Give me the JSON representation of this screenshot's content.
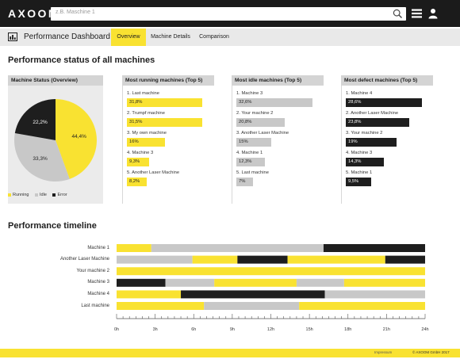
{
  "app": {
    "logo": "AXOOM",
    "search_placeholder": "z.B. Maschine 1"
  },
  "tabbar": {
    "title": "Performance Dashboard",
    "tabs": [
      {
        "label": "Overview",
        "active": true
      },
      {
        "label": "Machine Details",
        "active": false
      },
      {
        "label": "Comparison",
        "active": false
      }
    ]
  },
  "status_section": {
    "heading": "Performance status of all machines",
    "overview": {
      "title": "Machine Status (Overview)",
      "legend": [
        "Running",
        "Idle",
        "Error"
      ]
    },
    "top_running": {
      "title": "Most running machines (Top 5)",
      "items": [
        {
          "label": "1. Last machine",
          "value": "31,8%"
        },
        {
          "label": "2. Trumpf machine",
          "value": "31,5%"
        },
        {
          "label": "3. My own machine",
          "value": "16%"
        },
        {
          "label": "4. Machine 3",
          "value": "9,3%"
        },
        {
          "label": "5. Another Laser Machine",
          "value": "8,2%"
        }
      ]
    },
    "top_idle": {
      "title": "Most idle machines (Top 5)",
      "items": [
        {
          "label": "1. Machine 3",
          "value": "32,6%"
        },
        {
          "label": "2. Your machine 2",
          "value": "20,8%"
        },
        {
          "label": "3. Another Laser Machine",
          "value": "15%"
        },
        {
          "label": "4. Machine 1",
          "value": "12,3%"
        },
        {
          "label": "5. Last machine",
          "value": "7%"
        }
      ]
    },
    "top_defect": {
      "title": "Most defect machines (Top 5)",
      "items": [
        {
          "label": "1. Machine 4",
          "value": "28,6%"
        },
        {
          "label": "2. Another Laser Machine",
          "value": "23,8%"
        },
        {
          "label": "3. Your machine 2",
          "value": "19%"
        },
        {
          "label": "4. Machine 3",
          "value": "14,3%"
        },
        {
          "label": "5. Machine 1",
          "value": "9,5%"
        }
      ]
    }
  },
  "timeline_section": {
    "heading": "Performance timeline",
    "machines": [
      "Machine 1",
      "Another Laser Machine",
      "Your machine 2",
      "Machine 3",
      "Machine 4",
      "Last machine"
    ],
    "x_ticks": [
      "0h",
      "3h",
      "6h",
      "9h",
      "12h",
      "15h",
      "18h",
      "21h",
      "24h"
    ]
  },
  "footer": {
    "mid_text": "Impressum",
    "copyright": "© AXOOM GmbH 2017"
  },
  "colors": {
    "running": "#f9e231",
    "idle": "#c8c8c8",
    "error": "#1e1e1e"
  },
  "chart_data": [
    {
      "type": "pie",
      "title": "Machine Status (Overview)",
      "labels": [
        "Running",
        "Idle",
        "Error"
      ],
      "values": [
        44.4,
        33.3,
        22.2
      ],
      "value_labels": [
        "44,4%",
        "33,3%",
        "22,2%"
      ],
      "colors": [
        "#f9e231",
        "#c8c8c8",
        "#1e1e1e"
      ],
      "legend": "bottom"
    },
    {
      "type": "bar",
      "title": "Most running machines (Top 5)",
      "categories": [
        "Last machine",
        "Trumpf machine",
        "My own machine",
        "Machine 3",
        "Another Laser Machine"
      ],
      "values": [
        31.8,
        31.5,
        16,
        9.3,
        8.2
      ],
      "color": "#f9e231"
    },
    {
      "type": "bar",
      "title": "Most idle machines (Top 5)",
      "categories": [
        "Machine 3",
        "Your machine 2",
        "Another Laser Machine",
        "Machine 1",
        "Last machine"
      ],
      "values": [
        32.6,
        20.8,
        15,
        12.3,
        7
      ],
      "color": "#c8c8c8"
    },
    {
      "type": "bar",
      "title": "Most defect machines (Top 5)",
      "categories": [
        "Machine 4",
        "Another Laser Machine",
        "Your machine 2",
        "Machine 3",
        "Machine 1"
      ],
      "values": [
        28.6,
        23.8,
        19,
        14.3,
        9.5
      ],
      "color": "#1e1e1e"
    },
    {
      "type": "timeline",
      "title": "Performance timeline",
      "x_unit": "h",
      "xlim": [
        0,
        24
      ],
      "rows": [
        {
          "machine": "Machine 1",
          "segments": [
            {
              "state": "Running",
              "start": 0,
              "end": 2.7
            },
            {
              "state": "Idle",
              "start": 2.7,
              "end": 16.1
            },
            {
              "state": "Error",
              "start": 16.1,
              "end": 24
            }
          ]
        },
        {
          "machine": "Another Laser Machine",
          "segments": [
            {
              "state": "Idle",
              "start": 0,
              "end": 5.9
            },
            {
              "state": "Running",
              "start": 5.9,
              "end": 9.4
            },
            {
              "state": "Error",
              "start": 9.4,
              "end": 13.3
            },
            {
              "state": "Running",
              "start": 13.3,
              "end": 20.9
            },
            {
              "state": "Error",
              "start": 20.9,
              "end": 24
            }
          ]
        },
        {
          "machine": "Your machine 2",
          "segments": [
            {
              "state": "Running",
              "start": 0,
              "end": 24
            }
          ]
        },
        {
          "machine": "Machine 3",
          "segments": [
            {
              "state": "Error",
              "start": 0,
              "end": 3.8
            },
            {
              "state": "Idle",
              "start": 3.8,
              "end": 7.6
            },
            {
              "state": "Running",
              "start": 7.6,
              "end": 14
            },
            {
              "state": "Idle",
              "start": 14,
              "end": 17.7
            },
            {
              "state": "Running",
              "start": 17.7,
              "end": 24
            }
          ]
        },
        {
          "machine": "Machine 4",
          "segments": [
            {
              "state": "Running",
              "start": 0,
              "end": 5
            },
            {
              "state": "Error",
              "start": 5,
              "end": 16.2
            },
            {
              "state": "Idle",
              "start": 16.2,
              "end": 24
            }
          ]
        },
        {
          "machine": "Last machine",
          "segments": [
            {
              "state": "Running",
              "start": 0,
              "end": 6.8
            },
            {
              "state": "Idle",
              "start": 6.8,
              "end": 14.2
            },
            {
              "state": "Running",
              "start": 14.2,
              "end": 24
            }
          ]
        }
      ]
    }
  ]
}
